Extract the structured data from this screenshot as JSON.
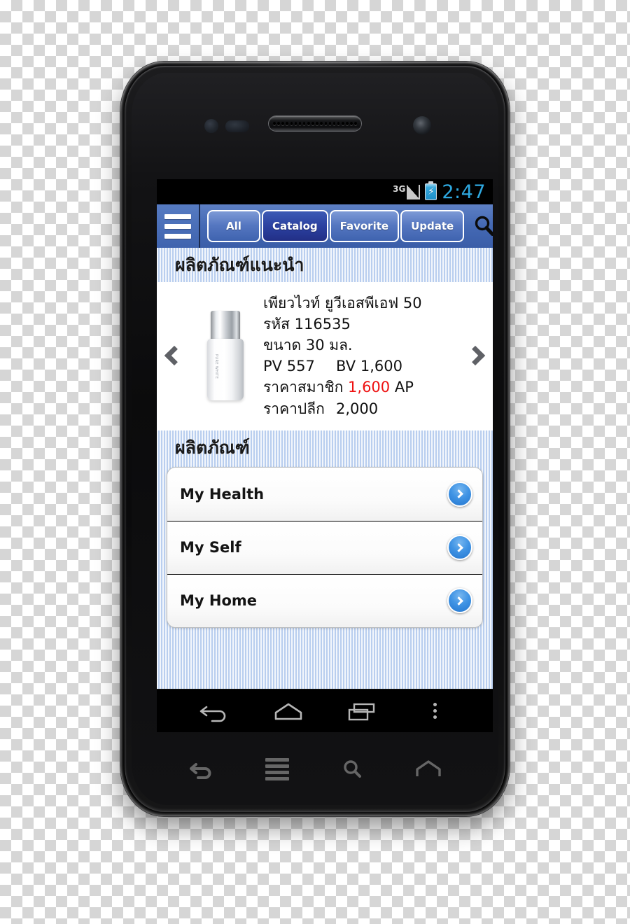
{
  "device": {
    "hardware": {
      "proximity_sensor": "proximity-sensor",
      "light_sensor": "light-sensor",
      "earpiece": "earpiece-speaker",
      "front_camera": "front-camera"
    },
    "capacitive_keys": [
      {
        "name": "back",
        "icon": "back-arrow-icon"
      },
      {
        "name": "menu",
        "icon": "menu-lines-icon"
      },
      {
        "name": "search",
        "icon": "search-icon"
      },
      {
        "name": "home",
        "icon": "home-icon"
      }
    ]
  },
  "statusbar": {
    "network": "3G",
    "signal_icon": "signal-triangle-icon",
    "battery_icon": "battery-charging-icon",
    "battery_bolt": "⚡",
    "time": "2:47",
    "time_color": "#2ea8e0"
  },
  "toolbar": {
    "menu_icon": "hamburger-menu-icon",
    "search_icon": "search-icon",
    "tabs": [
      {
        "label": "All",
        "selected": false
      },
      {
        "label": "Catalog",
        "selected": true
      },
      {
        "label": "Favorite",
        "selected": false
      },
      {
        "label": "Update",
        "selected": false
      }
    ],
    "accent": "#4469b4",
    "selected_color": "#2a3f9e"
  },
  "featured": {
    "section_title": "ผลิตภัณฑ์แนะนำ",
    "prev_icon": "chevron-left-icon",
    "next_icon": "chevron-right-icon",
    "product_image": "product-bottle-image",
    "product_image_label": "PURE WHITE",
    "name": "เพียวไวท์ ยูวีเอสพีเอฟ 50",
    "code_label": "รหัส",
    "code_value": "116535",
    "size_label": "ขนาด",
    "size_value": "30 มล.",
    "pv_label": "PV",
    "pv_value": "557",
    "bv_label": "BV",
    "bv_value": "1,600",
    "member_price_label": "ราคาสมาชิก",
    "member_price_value": "1,600",
    "member_price_unit": "AP",
    "member_price_color": "#ee1111",
    "retail_price_label": "ราคาปลีก",
    "retail_price_value": "2,000"
  },
  "catalog": {
    "section_title": "ผลิตภัณฑ์",
    "items": [
      {
        "label": "My Health",
        "go_icon": "chevron-right-circle-icon"
      },
      {
        "label": "My Self",
        "go_icon": "chevron-right-circle-icon"
      },
      {
        "label": "My Home",
        "go_icon": "chevron-right-circle-icon"
      }
    ]
  },
  "navbar": {
    "buttons": [
      {
        "name": "back",
        "icon": "back-arrow-icon"
      },
      {
        "name": "home",
        "icon": "home-icon"
      },
      {
        "name": "recents",
        "icon": "recent-apps-icon"
      },
      {
        "name": "overflow",
        "icon": "overflow-dots-icon"
      }
    ]
  }
}
